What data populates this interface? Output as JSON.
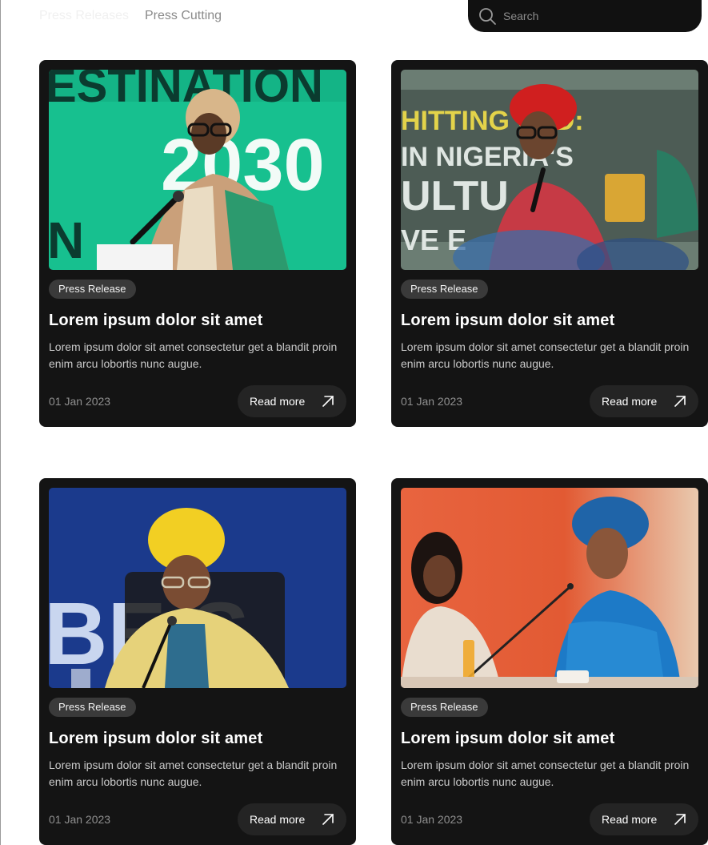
{
  "nav": {
    "tabs": [
      {
        "label": "Press Releases"
      },
      {
        "label": "Press Cutting"
      }
    ]
  },
  "search": {
    "placeholder": "Search",
    "icon": "search-icon"
  },
  "cards": [
    {
      "badge": "Press Release",
      "title": "Lorem ipsum dolor sit amet",
      "excerpt": "Lorem ipsum dolor sit amet consectetur get a blandit proin enim arcu lobortis nunc augue.",
      "date": "01 Jan 2023",
      "cta": "Read more"
    },
    {
      "badge": "Press Release",
      "title": "Lorem ipsum dolor sit amet",
      "excerpt": "Lorem ipsum dolor sit amet consectetur get a blandit proin enim arcu lobortis nunc augue.",
      "date": "01 Jan 2023",
      "cta": "Read more"
    },
    {
      "badge": "Press Release",
      "title": "Lorem ipsum dolor sit amet",
      "excerpt": "Lorem ipsum dolor sit amet consectetur get a blandit proin enim arcu lobortis nunc augue.",
      "date": "01 Jan 2023",
      "cta": "Read more"
    },
    {
      "badge": "Press Release",
      "title": "Lorem ipsum dolor sit amet",
      "excerpt": "Lorem ipsum dolor sit amet consectetur get a blandit proin enim arcu lobortis nunc augue.",
      "date": "01 Jan 2023",
      "cta": "Read more"
    }
  ],
  "photos": [
    {
      "banner_text": "ESTINATION",
      "year_text": "2030",
      "letter": "N"
    },
    {
      "banner_line1": "HITTING OLD:",
      "banner_line2": "IN NIGERIA'S",
      "banner_line3": "ULTU",
      "banner_line4": "VE E"
    },
    {
      "banner_text": "BE S"
    },
    {}
  ],
  "colors": {
    "card_bg": "#141414",
    "badge_bg": "#3a3a3a",
    "cta_bg": "#242424",
    "search_bg": "#111111"
  }
}
